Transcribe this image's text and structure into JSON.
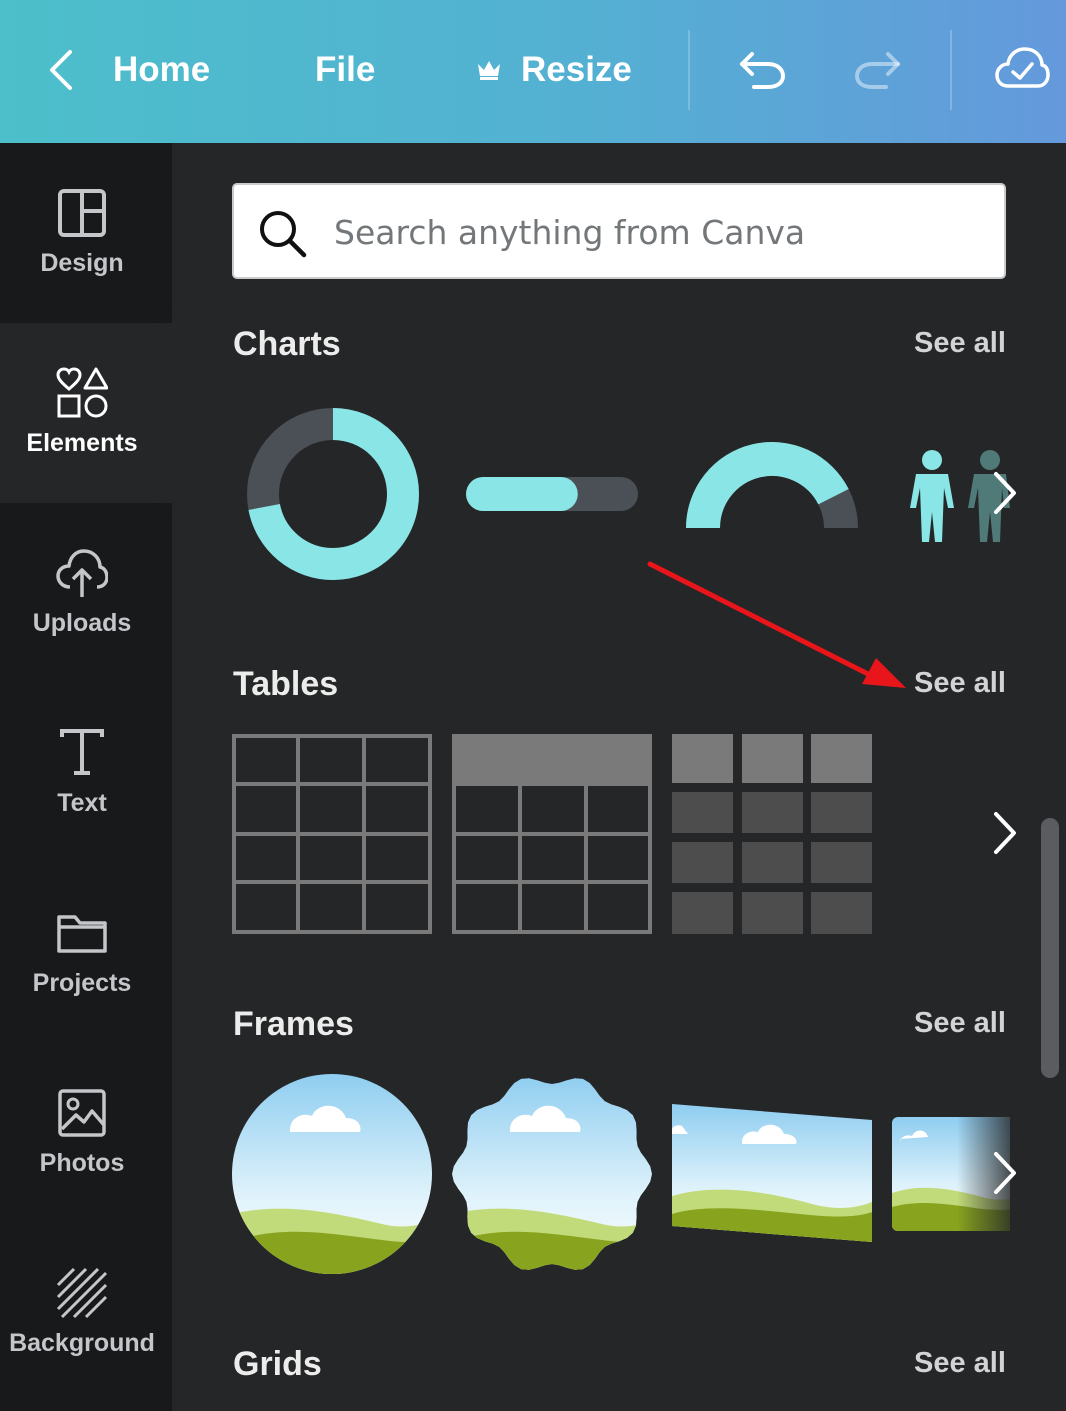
{
  "topbar": {
    "home_label": "Home",
    "file_label": "File",
    "resize_label": "Resize",
    "icons": [
      "back-chevron-icon",
      "crown-icon",
      "undo-icon",
      "redo-icon",
      "cloud-saved-icon"
    ]
  },
  "sidebar": {
    "items": [
      {
        "label": "Design",
        "icon": "layout-icon"
      },
      {
        "label": "Elements",
        "icon": "shapes-icon",
        "active": true
      },
      {
        "label": "Uploads",
        "icon": "cloud-upload-icon"
      },
      {
        "label": "Text",
        "icon": "text-icon"
      },
      {
        "label": "Projects",
        "icon": "folder-icon"
      },
      {
        "label": "Photos",
        "icon": "image-icon"
      },
      {
        "label": "Background",
        "icon": "stripes-icon"
      }
    ]
  },
  "search": {
    "placeholder": "Search anything from Canva"
  },
  "sections": [
    {
      "title": "Charts",
      "see_all": "See all"
    },
    {
      "title": "Tables",
      "see_all": "See all"
    },
    {
      "title": "Frames",
      "see_all": "See all"
    },
    {
      "title": "Grids",
      "see_all": "See all"
    }
  ],
  "charts": {
    "donut_fraction": 0.72,
    "progress_bar_fraction": 0.65,
    "gauge_fraction": 0.85
  },
  "colors": {
    "topbar_start": "#4cbfca",
    "topbar_end": "#6499dc",
    "panel_bg": "#252627",
    "sidebar_bg": "#18191b",
    "chart_accent": "#8ae5e6",
    "chart_track": "#4b4f56",
    "annotation_arrow": "#e8161b"
  }
}
